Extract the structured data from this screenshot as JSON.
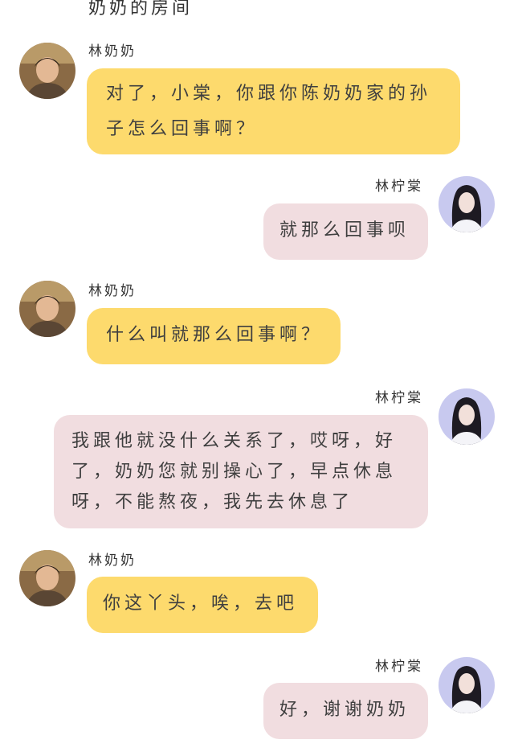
{
  "header": {
    "title": "奶奶的房间"
  },
  "colors": {
    "grandma_bubble": "#fdda6d",
    "user_bubble": "#f1dde0"
  },
  "messages": [
    {
      "sender": "林奶奶",
      "side": "left",
      "text": "对了，小棠，你跟你陈奶奶家的孙子怎么回事啊？",
      "avatar": "grandma-avatar"
    },
    {
      "sender": "林柠棠",
      "side": "right",
      "text": "就那么回事呗",
      "avatar": "girl-avatar"
    },
    {
      "sender": "林奶奶",
      "side": "left",
      "text": "什么叫就那么回事啊？",
      "avatar": "grandma-avatar"
    },
    {
      "sender": "林柠棠",
      "side": "right",
      "text": "我跟他就没什么关系了，哎呀，好了，奶奶您就别操心了，早点休息呀，不能熬夜，我先去休息了",
      "avatar": "girl-avatar"
    },
    {
      "sender": "林奶奶",
      "side": "left",
      "text": "你这丫头，唉，去吧",
      "avatar": "grandma-avatar"
    },
    {
      "sender": "林柠棠",
      "side": "right",
      "text": "好，谢谢奶奶",
      "avatar": "girl-avatar"
    }
  ]
}
